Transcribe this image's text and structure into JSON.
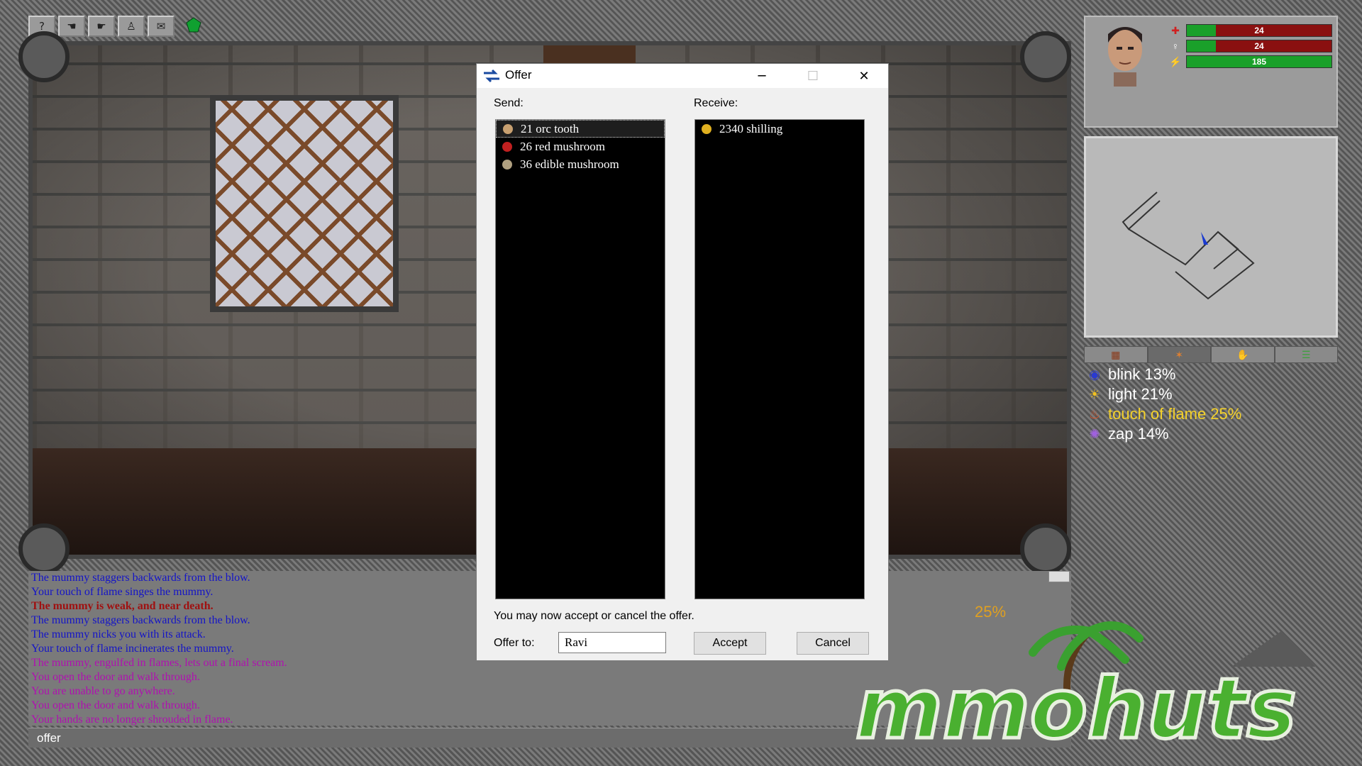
{
  "toolbar": {
    "buttons": [
      {
        "name": "help-button",
        "glyph": "?"
      },
      {
        "name": "left-hand-button",
        "glyph": "☚"
      },
      {
        "name": "right-hand-button",
        "glyph": "☛"
      },
      {
        "name": "character-button",
        "glyph": "♙"
      },
      {
        "name": "mail-button",
        "glyph": "✉"
      }
    ]
  },
  "dialog": {
    "title": "Offer",
    "minimize": "─",
    "maximize": "☐",
    "close": "✕",
    "send_label": "Send:",
    "receive_label": "Receive:",
    "send_items": [
      {
        "text": "21 orc tooth",
        "icon": "tooth-icon",
        "color": "#c8a070"
      },
      {
        "text": "26 red mushroom",
        "icon": "red-mushroom-icon",
        "color": "#c02020"
      },
      {
        "text": "36 edible mushroom",
        "icon": "mushroom-icon",
        "color": "#b0a080"
      }
    ],
    "receive_items": [
      {
        "text": "2340 shilling",
        "icon": "coin-icon",
        "color": "#e0b020"
      }
    ],
    "status": "You may now accept or cancel the offer.",
    "offer_to_label": "Offer to:",
    "offer_to_value": "Ravi",
    "accept": "Accept",
    "cancel": "Cancel"
  },
  "character": {
    "bars": [
      {
        "label": "24",
        "fill": 0.2,
        "icon": "health-icon",
        "color": "#d02020"
      },
      {
        "label": "24",
        "fill": 0.2,
        "icon": "mana-icon",
        "color": "#ffffff"
      },
      {
        "label": "185",
        "fill": 1.0,
        "icon": "stamina-icon",
        "color": "#f0d020"
      }
    ]
  },
  "spells": [
    {
      "text": "blink 13%",
      "icon": "eye-icon",
      "highlight": false
    },
    {
      "text": "light 21%",
      "icon": "sun-icon",
      "highlight": false
    },
    {
      "text": "touch of flame 25%",
      "icon": "flame-icon",
      "highlight": true
    },
    {
      "text": "zap 14%",
      "icon": "lightning-icon",
      "highlight": false
    }
  ],
  "log": [
    {
      "text": "The mummy staggers backwards from the blow.",
      "color": "#1414c8",
      "bold": false
    },
    {
      "text": "Your touch of flame singes the mummy.",
      "color": "#1414c8",
      "bold": false
    },
    {
      "text": "The mummy is weak, and near death.",
      "color": "#a01010",
      "bold": true
    },
    {
      "text": "The mummy staggers backwards from the blow.",
      "color": "#1414c8",
      "bold": false
    },
    {
      "text": "The mummy nicks you with its attack.",
      "color": "#1414c8",
      "bold": false
    },
    {
      "text": "Your touch of flame incinerates the mummy.",
      "color": "#1414c8",
      "bold": false
    },
    {
      "text": "The mummy, engulfed in flames, lets out a final scream.",
      "color": "#b010b0",
      "bold": false
    },
    {
      "text": "You open the door and walk through.",
      "color": "#b010b0",
      "bold": false
    },
    {
      "text": "You are unable to go anywhere.",
      "color": "#b010b0",
      "bold": false
    },
    {
      "text": "You open the door and walk through.",
      "color": "#b010b0",
      "bold": false
    },
    {
      "text": "Your hands are no longer shrouded in flame.",
      "color": "#b010b0",
      "bold": false
    }
  ],
  "input_text": "offer",
  "progress_text": "25%",
  "watermark": "mmohuts"
}
